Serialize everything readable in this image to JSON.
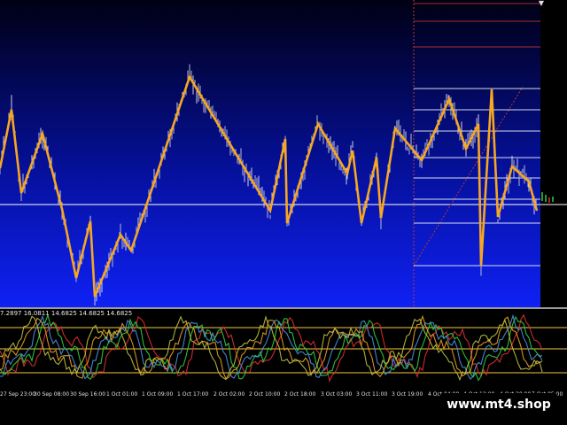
{
  "indicator": {
    "readout": "7.2897 16.0811 14.6825 14.6825 14.6825"
  },
  "time_axis": {
    "labels": [
      "27 Sep 23:00",
      "30 Sep 08:00",
      "30 Sep 16:00",
      "1 Oct 01:00",
      "1 Oct 09:00",
      "1 Oct 17:00",
      "2 Oct 02:00",
      "2 Oct 10:00",
      "2 Oct 18:00",
      "3 Oct 03:00",
      "3 Oct 11:00",
      "3 Oct 19:00",
      "4 Oct 04:00",
      "4 Oct 12:00",
      "4 Oct 20:00",
      "7 Oct 05:00"
    ]
  },
  "watermark": {
    "text": "www.mt4.shop"
  },
  "colors": {
    "background_top": "#000018",
    "background_bottom": "#0e1ff2",
    "zigzag": "#f5a623",
    "candles": "#c8c8d8",
    "level_line": "#ffffff",
    "fib_red": "#c0392b",
    "indicator_level": "#f5c842",
    "indicator_red": "#e03030",
    "indicator_green": "#30d040",
    "indicator_blue": "#4a90e2"
  },
  "icons": {
    "close": "close-icon"
  }
}
